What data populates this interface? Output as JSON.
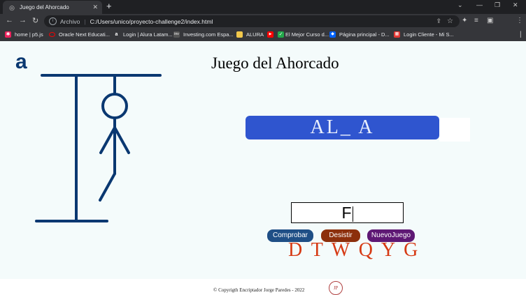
{
  "browser": {
    "tab_title": "Juego del Ahorcado",
    "url_scheme_label": "Archivo",
    "url": "C:/Users/unico/proyecto-challenge2/index.html",
    "bookmarks": [
      {
        "label": "home | p5.js",
        "color": "#ed225d"
      },
      {
        "label": "Oracle Next Educati...",
        "color": "#f80000"
      },
      {
        "label": "Login | Alura Latam...",
        "color": "#0a3871"
      },
      {
        "label": "Investing.com Espa...",
        "color": "#777777"
      },
      {
        "label": "ALURA",
        "color": "#f2c84b"
      },
      {
        "label": "",
        "color": "#ff0000"
      },
      {
        "label": "El Mejor Curso d...",
        "color": "#22a84a"
      },
      {
        "label": "Página principal - D...",
        "color": "#0061fe"
      },
      {
        "label": "Login Cliente - Mi S...",
        "color": "#e53935"
      }
    ]
  },
  "page": {
    "logo": "a",
    "title": "Juego del Ahorcado",
    "word_display": "AL_ A",
    "input_value": "F",
    "buttons": {
      "check": "Comprobar",
      "give_up": "Desistir",
      "new_game": "NuevoJuego"
    },
    "wrong_letters": "D T W Q Y G",
    "footer_text": "© Copyrigth Encriptador Jorge Paredes - 2022",
    "footer_logo": "JP"
  },
  "colors": {
    "gallows": "#0a3871",
    "word_box": "#2f55cf",
    "wrong_letters": "#d63a14",
    "btn_check": "#1f4f86",
    "btn_give_up": "#8c2f0c",
    "btn_new": "#5e1874"
  }
}
